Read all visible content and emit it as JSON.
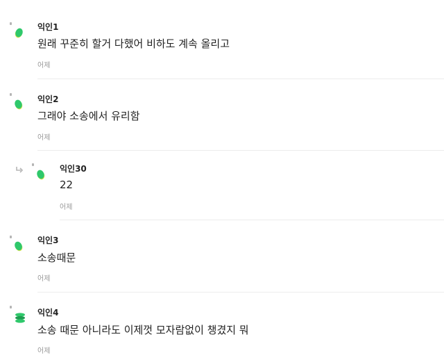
{
  "comments": [
    {
      "author": "익인1",
      "text": "원래 꾸준히 할거 다했어 비하도 계속 올리고",
      "time": "어제",
      "avatar_icon": "green-leaf-icon"
    },
    {
      "author": "익인2",
      "text": "그래야 소송에서 유리함",
      "time": "어제",
      "avatar_icon": "green-leaf-icon"
    },
    {
      "author": "익인30",
      "text": "22",
      "time": "어제",
      "avatar_icon": "green-leaf-icon",
      "is_reply": true
    },
    {
      "author": "익인3",
      "text": "소송때문",
      "time": "어제",
      "avatar_icon": "green-leaf-icon"
    },
    {
      "author": "익인4",
      "text": "소송 때문 아니라도 이제껏 모자람없이 챙겼지 뭐",
      "time": "어제",
      "avatar_icon": "green-stack-icon"
    }
  ],
  "colors": {
    "avatar_green": "#2fc86b",
    "avatar_green_dark": "#1e9c50",
    "avatar_yellow": "#d8e24a",
    "text": "#222222",
    "meta": "#9a9a9a",
    "divider": "#ececec"
  }
}
